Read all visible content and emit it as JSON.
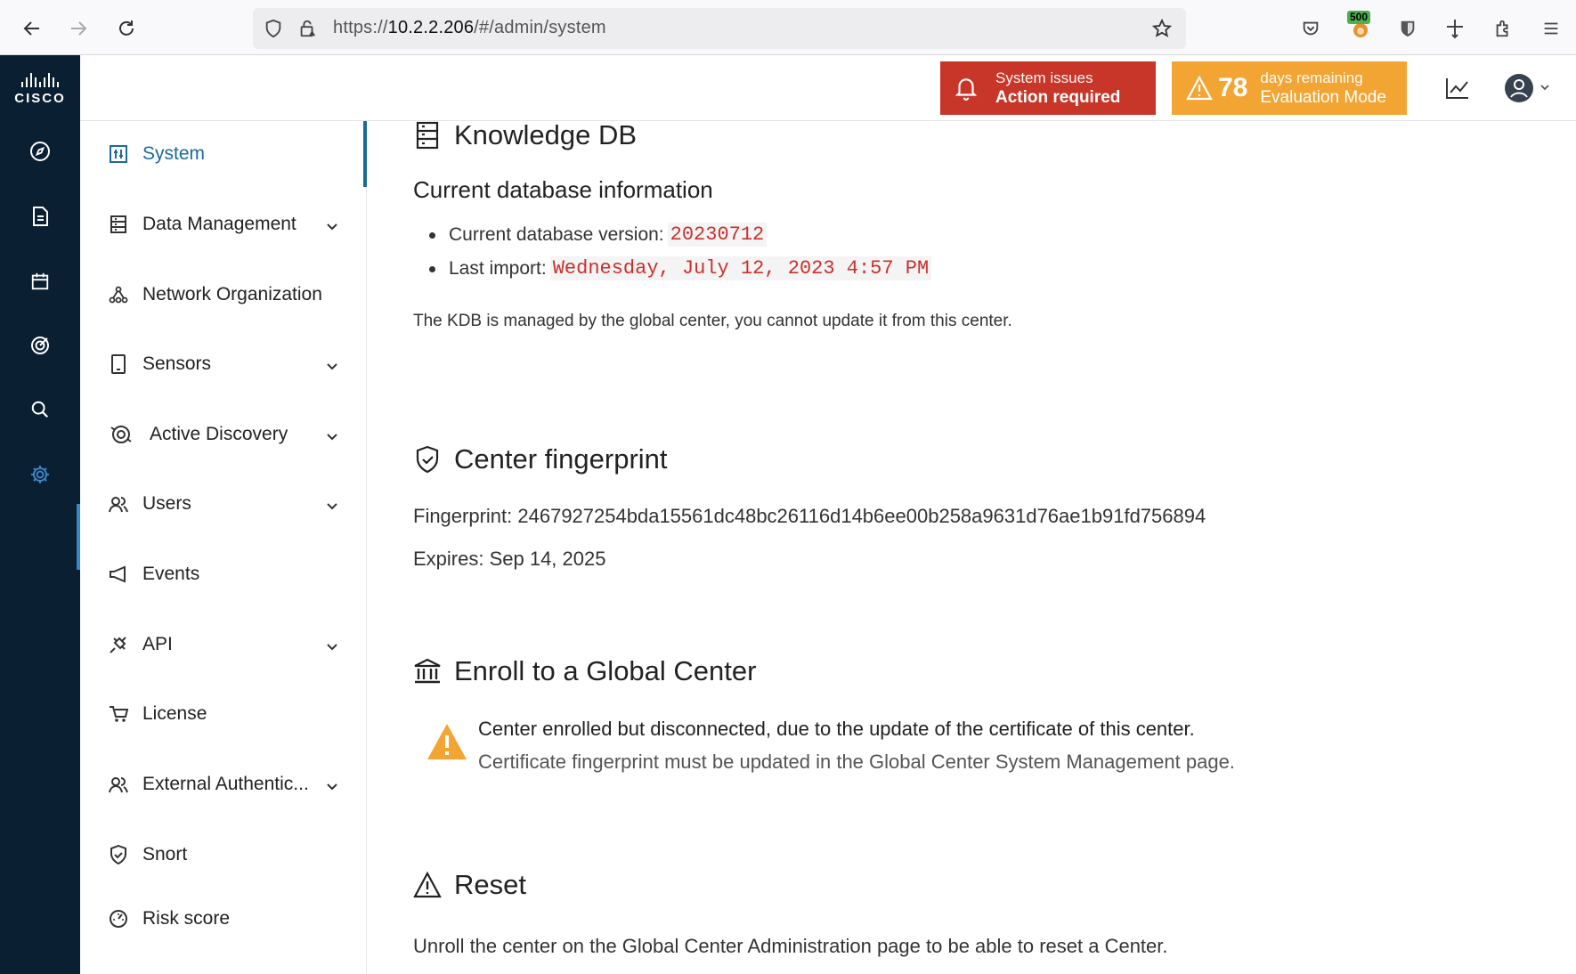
{
  "browser": {
    "url_prefix": "https://",
    "url_host": "10.2.2.206",
    "url_path": "/#/admin/system",
    "extension_badge": "500"
  },
  "rail": {
    "logo": "CISCO",
    "items": [
      "compass-icon",
      "document-icon",
      "calendar-icon",
      "target-icon",
      "search-icon",
      "gear-icon"
    ]
  },
  "header": {
    "system_issues": "System issues",
    "action_required": "Action required",
    "days": "78",
    "days_remaining": "days remaining",
    "evaluation_mode": "Evaluation Mode",
    "colors": {
      "red": "#c73628",
      "orange": "#f3a534"
    }
  },
  "sidebar": {
    "items": [
      {
        "label": "System",
        "icon": "sliders-icon",
        "active": true
      },
      {
        "label": "Data Management",
        "icon": "database-icon",
        "expandable": true
      },
      {
        "label": "Network Organization",
        "icon": "network-icon"
      },
      {
        "label": "Sensors",
        "icon": "tablet-icon",
        "expandable": true
      },
      {
        "label": "Active Discovery",
        "icon": "radar-icon",
        "expandable": true
      },
      {
        "label": "Users",
        "icon": "users-icon",
        "expandable": true
      },
      {
        "label": "Events",
        "icon": "megaphone-icon"
      },
      {
        "label": "API",
        "icon": "plug-icon",
        "expandable": true
      },
      {
        "label": "License",
        "icon": "cart-icon"
      },
      {
        "label": "External Authentic...",
        "icon": "users-icon",
        "expandable": true
      },
      {
        "label": "Snort",
        "icon": "shield-icon"
      },
      {
        "label": "Risk score",
        "icon": "gauge-icon"
      }
    ]
  },
  "main": {
    "kdb": {
      "title": "Knowledge DB",
      "subtitle": "Current database information",
      "version_label": "Current database version:",
      "version_value": "20230712",
      "import_label": "Last import:",
      "import_value": "Wednesday, July 12, 2023 4:57 PM",
      "note": "The KDB is managed by the global center, you cannot update it from this center."
    },
    "fingerprint": {
      "title": "Center fingerprint",
      "fingerprint_line": "Fingerprint: 2467927254bda15561dc48bc26116d14b6ee00b258a9631d76ae1b91fd756894",
      "expires_line": "Expires: Sep 14, 2025"
    },
    "enroll": {
      "title": "Enroll to a Global Center",
      "warning_title": "Center enrolled but disconnected, due to the update of the certificate of this center.",
      "warning_text": "Certificate fingerprint must be updated in the Global Center System Management page."
    },
    "reset": {
      "title": "Reset",
      "text": "Unroll the center on the Global Center Administration page to be able to reset a Center."
    }
  }
}
